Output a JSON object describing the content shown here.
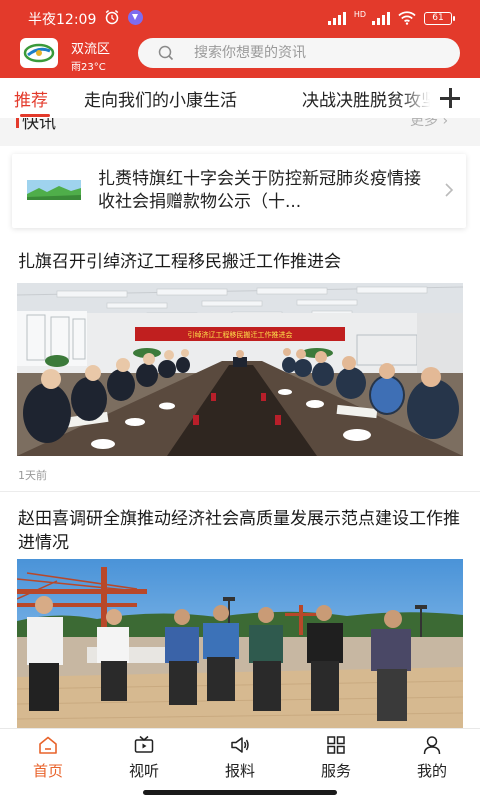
{
  "status": {
    "time": "半夜12:09",
    "signal_label": "HD",
    "battery": "61"
  },
  "header": {
    "city": "双流区",
    "weather": "雨23°C",
    "search_placeholder": "搜索你想要的资讯"
  },
  "tabs": [
    {
      "label": "推荐",
      "active": true
    },
    {
      "label": "走向我们的小康生活",
      "active": false
    },
    {
      "label": "决战决胜脱贫攻坚",
      "active": false
    }
  ],
  "kuaixun": {
    "title": "快讯",
    "more": "更多 ›",
    "item": "扎赉特旗红十字会关于防控新冠肺炎疫情接收社会捐赠款物公示（十..."
  },
  "news": [
    {
      "title": "扎旗召开引绰济辽工程移民搬迁工作推进会",
      "banner": "引绰济辽工程移民搬迁工作推进会",
      "time": "1天前"
    },
    {
      "title": "赵田喜调研全旗推动经济社会高质量发展示范点建设工作推进情况"
    }
  ],
  "bottom_nav": [
    {
      "label": "首页",
      "icon": "home-icon",
      "active": true
    },
    {
      "label": "视听",
      "icon": "tv-icon",
      "active": false
    },
    {
      "label": "报料",
      "icon": "megaphone-icon",
      "active": false
    },
    {
      "label": "服务",
      "icon": "grid-icon",
      "active": false
    },
    {
      "label": "我的",
      "icon": "person-icon",
      "active": false
    }
  ],
  "colors": {
    "brand_red": "#e33a2b",
    "nav_active": "#e8632b"
  }
}
